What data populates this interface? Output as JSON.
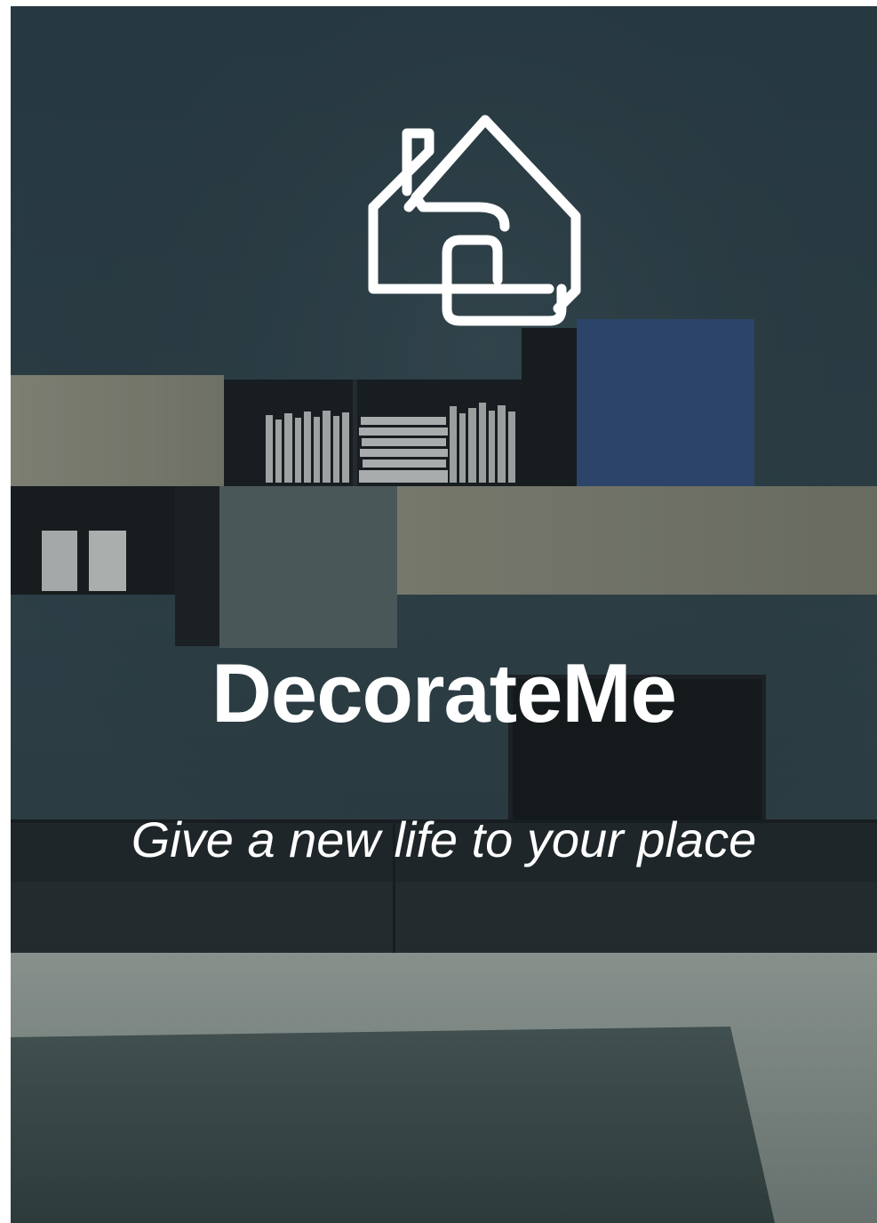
{
  "splash": {
    "logo_icon": "house-icon",
    "app_name": "DecorateMe",
    "tagline": "Give a new life to your place"
  },
  "colors": {
    "text": "#ffffff",
    "wall": "#33474f",
    "accent_blue": "#3a5a8c"
  }
}
